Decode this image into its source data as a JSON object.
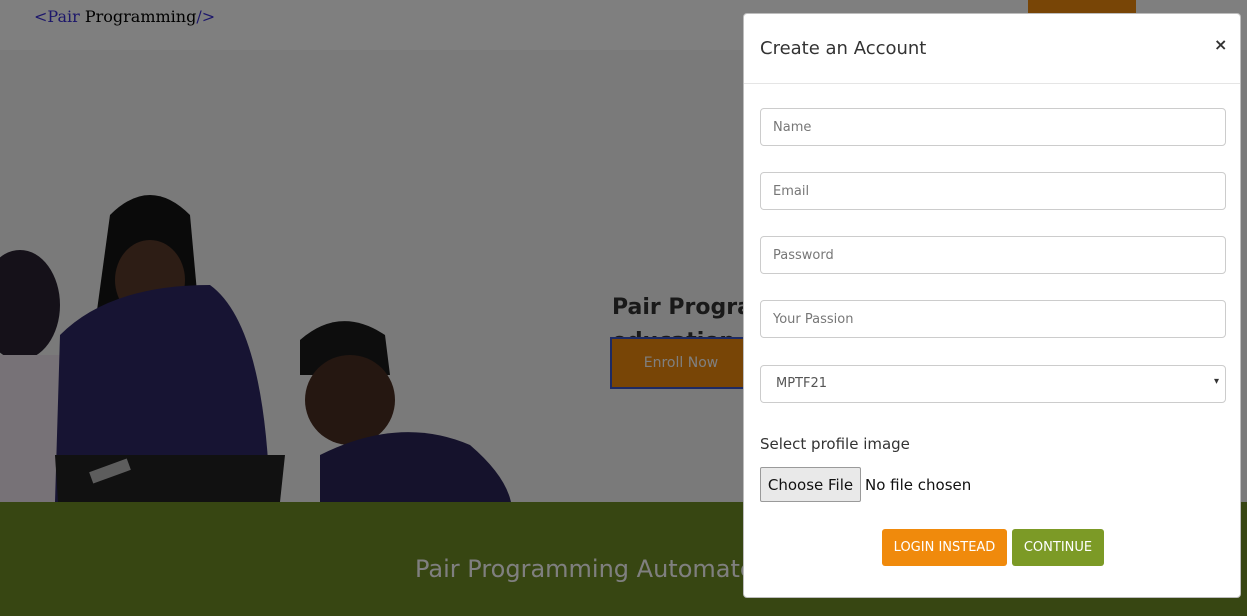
{
  "brand": {
    "open": "<Pair",
    "name": " Programming",
    "close": "/>"
  },
  "hero": {
    "headline_line1": "Pair Programm",
    "headline_line2": "education.",
    "enroll_label": "Enroll Now"
  },
  "footer": {
    "title": "Pair Programming Automatec"
  },
  "modal": {
    "title": "Create an Account",
    "close_label": "×",
    "fields": {
      "name_placeholder": "Name",
      "email_placeholder": "Email",
      "password_placeholder": "Password",
      "passion_placeholder": "Your Passion"
    },
    "cohort_select": {
      "value": "MPTF21",
      "caret": "▾"
    },
    "profile_image_label": "Select profile image",
    "choose_file_label": "Choose File",
    "no_file_text": "No file chosen",
    "login_label": "LOGIN INSTEAD",
    "continue_label": "CONTINUE"
  },
  "colors": {
    "accent_orange": "#f08a0c",
    "accent_green": "#7c9a26",
    "footer_green": "#6f8c25",
    "brand_tag": "#3a2fd6"
  }
}
